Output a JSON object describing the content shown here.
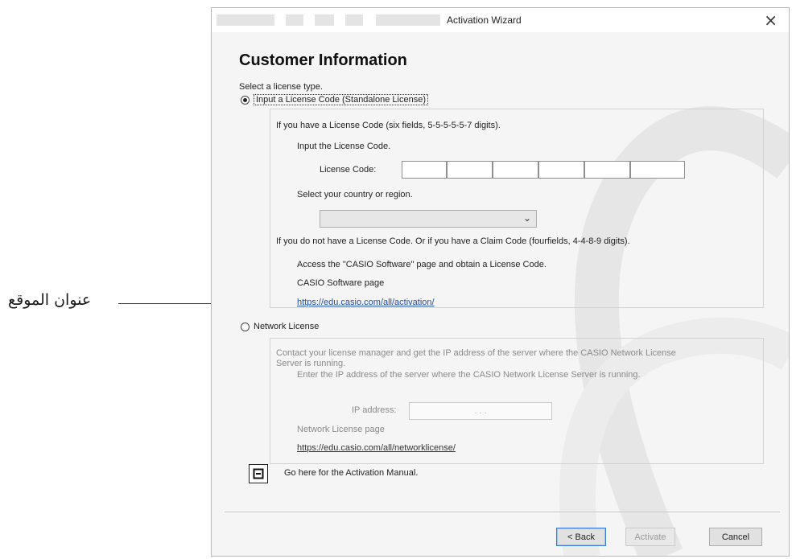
{
  "annotation": {
    "label": "عنوان الموقع"
  },
  "window": {
    "title": "Activation Wizard",
    "close_glyph": "×"
  },
  "page": {
    "heading": "Customer Information",
    "select_prompt": "Select a license type."
  },
  "standalone": {
    "radio_label": "Input a License Code (Standalone License)",
    "selected": true,
    "intro": "If you have a License Code (six fields, 5-5-5-5-5-7 digits).",
    "input_prompt": "Input the License Code.",
    "code_label": "License Code:",
    "code_fields": [
      "",
      "",
      "",
      "",
      "",
      ""
    ],
    "country_prompt": "Select your country or region.",
    "country_value": "",
    "no_code_text": "If you do not have a License Code. Or if you have a Claim Code (fourfields, 4-4-8-9 digits).",
    "access_text": "Access the \"CASIO Software\" page and obtain a License Code.",
    "software_page_label": "CASIO Software page",
    "software_page_url": "https://edu.casio.com/all/activation/"
  },
  "network": {
    "radio_label": "Network License",
    "selected": false,
    "contact_text_1": "Contact your license manager and get the IP address of the server where the CASIO Network License",
    "contact_text_2": "Server is running.",
    "enter_ip_text": "Enter the IP address of the server where the CASIO Network License Server is running.",
    "ip_label": "IP address:",
    "ip_placeholder": ".     .     .",
    "network_page_label": "Network License page",
    "network_page_url": "https://edu.casio.com/all/networklicense/"
  },
  "manual": {
    "icon": "document-icon",
    "text": "Go here for the Activation Manual."
  },
  "buttons": {
    "back": "< Back",
    "activate": "Activate",
    "cancel": "Cancel"
  }
}
